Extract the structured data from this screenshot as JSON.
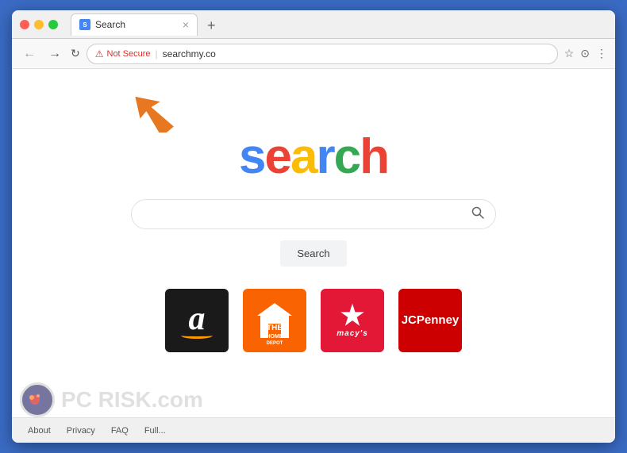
{
  "browser": {
    "tab_title": "Search",
    "new_tab_icon": "+",
    "close_icon": "×"
  },
  "address_bar": {
    "back_icon": "←",
    "forward_icon": "→",
    "refresh_icon": "↻",
    "security_label": "Not Secure",
    "url": "searchmy.co",
    "bookmark_icon": "☆",
    "account_icon": "⊙",
    "menu_icon": "⋮"
  },
  "page": {
    "logo_letters": [
      {
        "char": "s",
        "color_class": "s-blue"
      },
      {
        "char": "e",
        "color_class": "e-red"
      },
      {
        "char": "a",
        "color_class": "a-yellow"
      },
      {
        "char": "r",
        "color_class": "r-blue"
      },
      {
        "char": "c",
        "color_class": "c-green"
      },
      {
        "char": "h",
        "color_class": "h-red"
      }
    ],
    "search_placeholder": "",
    "search_button_label": "Search",
    "brands": [
      {
        "name": "Amazon",
        "id": "amazon"
      },
      {
        "name": "Home Depot",
        "id": "homedepot"
      },
      {
        "name": "Macys",
        "id": "macys"
      },
      {
        "name": "JCPenney",
        "id": "jcpenney"
      }
    ]
  },
  "footer": {
    "links": [
      "About",
      "Privacy",
      "FAQ",
      "Full..."
    ]
  },
  "watermark": {
    "text": "PC RISK.com"
  }
}
